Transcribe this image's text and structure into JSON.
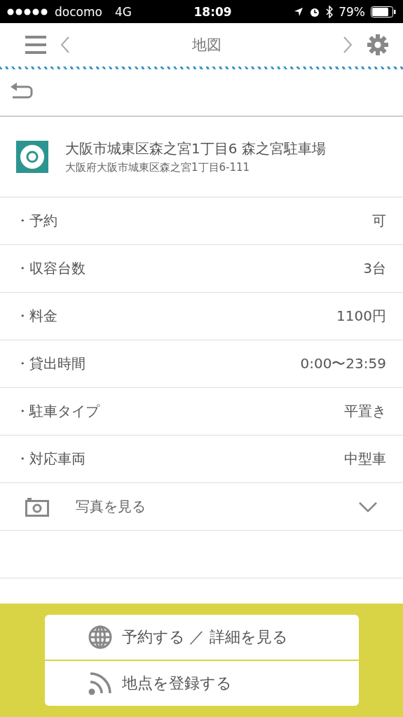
{
  "status_bar": {
    "carrier": "docomo",
    "network": "4G",
    "time": "18:09",
    "battery": "79%"
  },
  "header": {
    "title": "地図"
  },
  "place": {
    "name": "大阪市城東区森之宮1丁目6 森之宮駐車場",
    "address": "大阪府大阪市城東区森之宮1丁目6-111"
  },
  "details": [
    {
      "label": "・予約",
      "value": "可"
    },
    {
      "label": "・収容台数",
      "value": "3台"
    },
    {
      "label": "・料金",
      "value": "1100円"
    },
    {
      "label": "・貸出時間",
      "value": "0:00〜23:59"
    },
    {
      "label": "・駐車タイプ",
      "value": "平置き"
    },
    {
      "label": "・対応車両",
      "value": "中型車"
    }
  ],
  "photos": {
    "label": "写真を見る",
    "expanded": false
  },
  "actions": [
    {
      "kind": "globe",
      "label": "予約する ／ 詳細を見る"
    },
    {
      "kind": "feed",
      "label": "地点を登録する"
    }
  ]
}
